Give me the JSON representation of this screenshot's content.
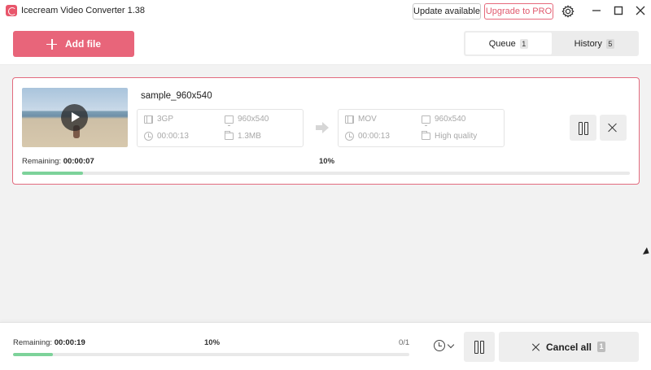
{
  "window": {
    "title": "Icecream Video Converter 1.38",
    "update_label": "Update available",
    "pro_label": "Upgrade to PRO"
  },
  "toolbar": {
    "add_file_label": "Add file"
  },
  "tabs": [
    {
      "label": "Queue",
      "count": "1",
      "active": true
    },
    {
      "label": "History",
      "count": "5",
      "active": false
    }
  ],
  "task": {
    "filename": "sample_960x540",
    "source": {
      "format": "3GP",
      "resolution": "960x540",
      "duration": "00:00:13",
      "size": "1.3MB"
    },
    "target": {
      "format": "MOV",
      "resolution": "960x540",
      "duration": "00:00:13",
      "quality": "High quality"
    },
    "remaining_label": "Remaining:",
    "remaining_time": "00:00:07",
    "progress_label": "10%",
    "progress": 0.1
  },
  "footer": {
    "remaining_label": "Remaining:",
    "remaining_time": "00:00:19",
    "progress_label": "10%",
    "progress": 0.1,
    "count_text": "0/1",
    "cancel_all_label": "Cancel all",
    "cancel_all_count": "1"
  },
  "colors": {
    "accent": "#e8657a",
    "progress": "#7dd29a"
  },
  "icons": [
    "app-logo-icon",
    "gear-icon",
    "minimize-icon",
    "maximize-icon",
    "close-icon",
    "plus-icon",
    "play-icon",
    "film-icon",
    "screen-icon",
    "clock-icon",
    "folder-icon",
    "arrow-right-icon",
    "pause-icon",
    "close-task-icon",
    "timer-icon",
    "chevron-down-icon"
  ]
}
